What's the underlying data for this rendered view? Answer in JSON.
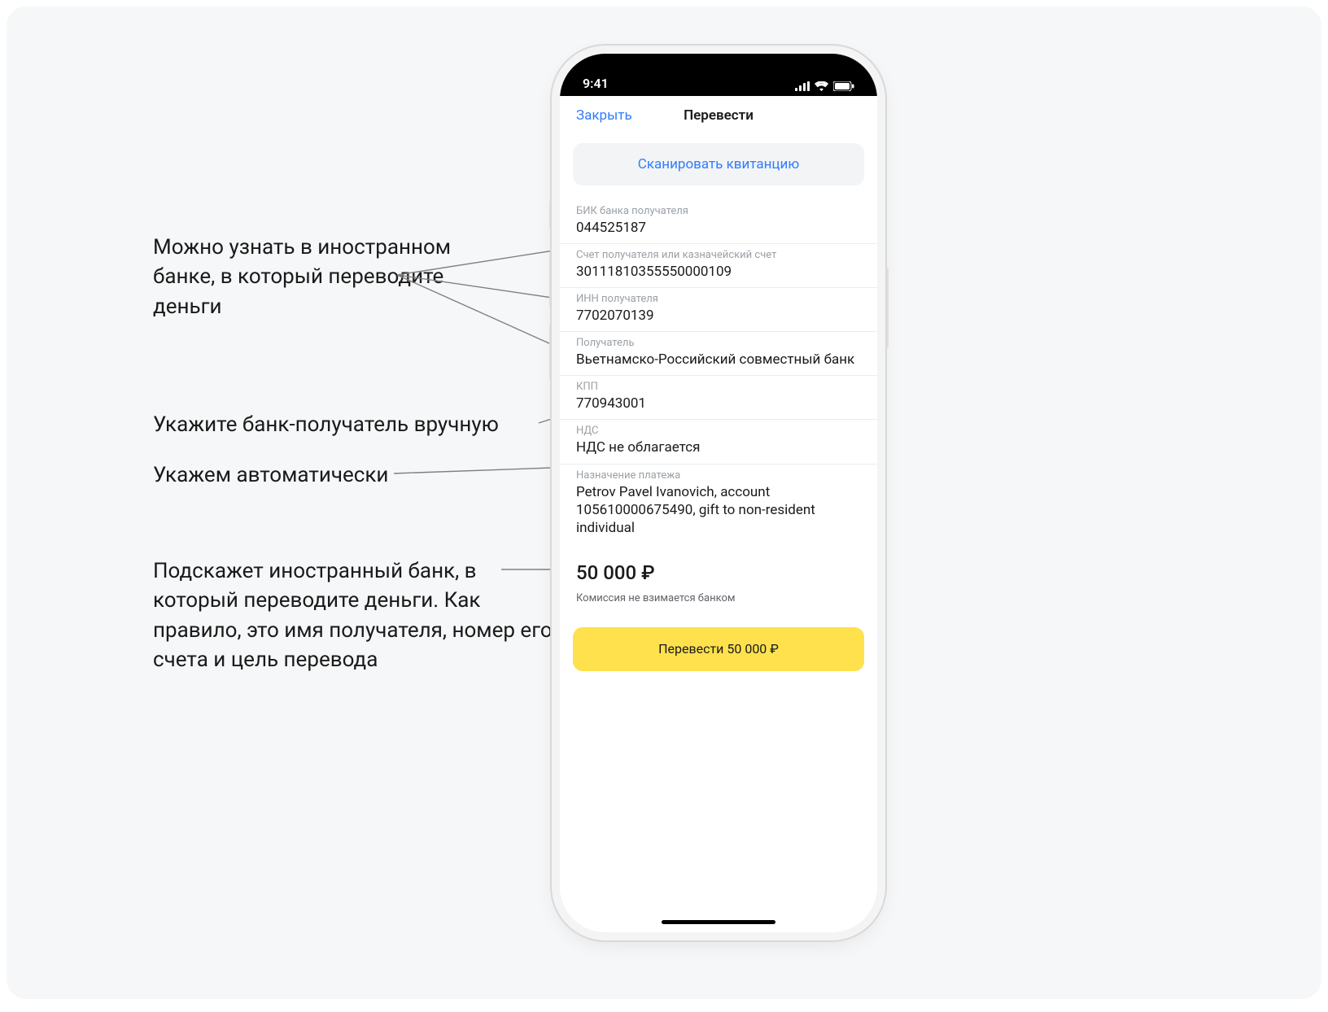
{
  "annotations": {
    "a1": "Можно узнать в иностранном банке, в который переводите деньги",
    "a2": "Укажите банк-получатель вручную",
    "a3": "Укажем автоматически",
    "a4": "Подскажет иностранный банк, в который переводите деньги. Как правило, это имя получателя, номер его счета и цель перевода"
  },
  "status": {
    "time": "9:41"
  },
  "nav": {
    "close_label": "Закрыть",
    "title": "Перевести"
  },
  "scan": {
    "label": "Сканировать квитанцию"
  },
  "fields": {
    "bik": {
      "label": "БИК банка получателя",
      "value": "044525187"
    },
    "account": {
      "label": "Счет получателя или казначейский счет",
      "value": "30111810355550000109"
    },
    "inn": {
      "label": "ИНН получателя",
      "value": "7702070139"
    },
    "payee": {
      "label": "Получатель",
      "value": "Вьетнамско-Российский совместный банк"
    },
    "kpp": {
      "label": "КПП",
      "value": "770943001"
    },
    "vat": {
      "label": "НДС",
      "value": "НДС не облагается"
    },
    "purpose": {
      "label": "Назначение платежа",
      "value": "Petrov Pavel Ivanovich, account 105610000675490, gift to non-resident individual"
    }
  },
  "amount": {
    "display": "50 000 ₽",
    "fee_note": "Комиссия не взимается банком"
  },
  "primary_button": {
    "label": "Перевести 50 000 ₽"
  }
}
